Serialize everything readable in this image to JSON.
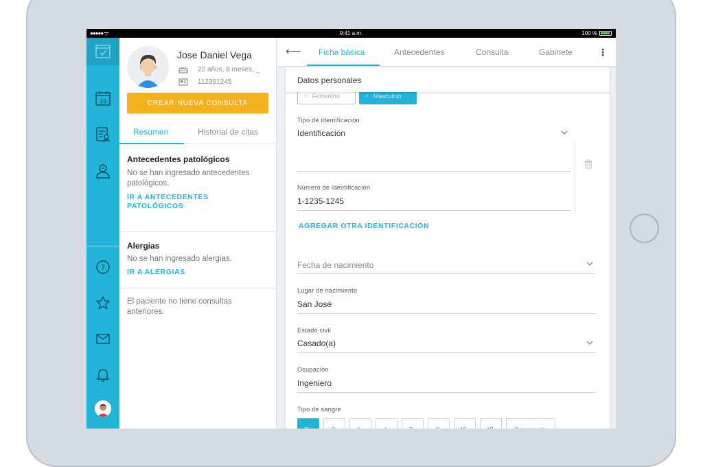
{
  "status_bar": {
    "time": "9:41 a.m.",
    "battery": "100 %"
  },
  "patient": {
    "name": "Jose Daniel Vega",
    "age": "22 años, 8 meses, _",
    "id_number": "112351245",
    "new_consult_label": "CREAR NUEVA CONSULTA"
  },
  "left_tabs": {
    "summary": "Resumen",
    "history": "Historial de citas"
  },
  "sections": {
    "pathological": {
      "title": "Antecedentes patológicos",
      "text": "No se han ingresado antecedentes patológicos.",
      "link": "IR A ANTECEDENTES PATOLÓGICOS"
    },
    "allergies": {
      "title": "Alergias",
      "text": "No se han ingresado alergias.",
      "link": "IR A ALERGIAS"
    },
    "consults": {
      "text": "El paciente no tiene consultas anteriores."
    }
  },
  "top_tabs": [
    "Ficha básica",
    "Antecedentes",
    "Consulta",
    "Gabinete"
  ],
  "form": {
    "header": "Datos personales",
    "gender_female": "Femenino",
    "gender_male": "Masculino",
    "id_type_label": "Tipo de identificación",
    "id_type_value": "Identificación",
    "id_number_label": "Número de identificación",
    "id_number_value": "1-1235-1245",
    "add_id_link": "AGREGAR OTRA IDENTIFICACIÓN",
    "birthdate_placeholder": "Fecha de nacimiento",
    "birthplace_label": "Lugar de nacimiento",
    "birthplace_value": "San José",
    "civil_label": "Estado civil",
    "civil_value": "Casado(a)",
    "occupation_label": "Ocupación",
    "occupation_value": "Ingeniero",
    "blood_label": "Tipo de sangre",
    "blood_types": [
      "O+",
      "O-",
      "A+",
      "A-",
      "B+",
      "B-",
      "AB+",
      "AB-",
      "Desconocido"
    ],
    "blood_selected": "O+"
  },
  "colors": {
    "accent": "#22b4d9",
    "cta": "#f6b21e"
  },
  "icons": [
    "checklist-icon",
    "calendar-icon",
    "records-icon",
    "patient-icon",
    "help-icon",
    "star-icon",
    "mail-icon",
    "bell-icon"
  ]
}
